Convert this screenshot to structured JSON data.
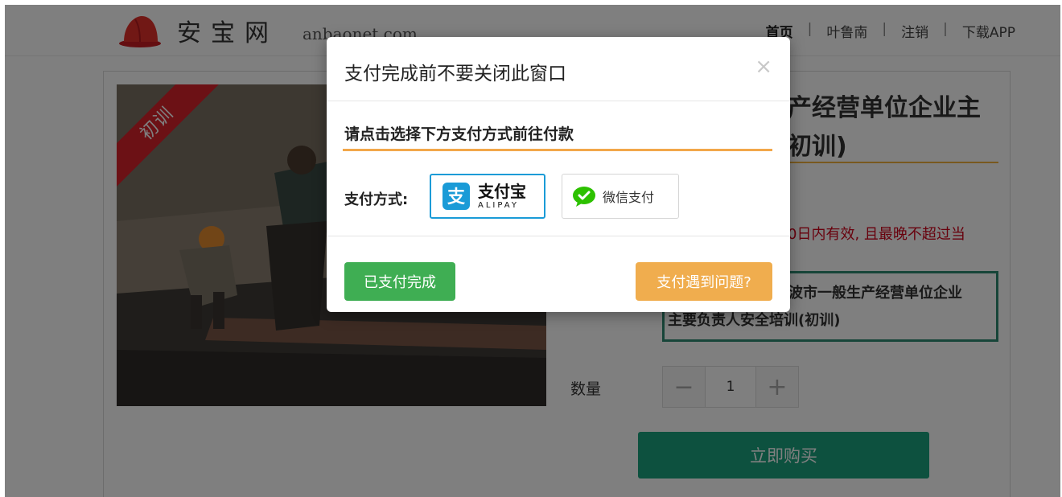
{
  "header": {
    "logo_cn": "安宝网",
    "logo_en": "anbaonet.com",
    "nav": {
      "home": "首页",
      "user": "叶鲁南",
      "logout": "注销",
      "download": "下载APP",
      "separator": "|"
    }
  },
  "product": {
    "ribbon": "初训",
    "title_lines": [
      "产经营单位企业主",
      "初训)"
    ],
    "validity": "0日内有效, 且最晚不超过当",
    "course_lines": [
      "波市一般生产经营单位企业",
      "主要负责人安全培训(初训)"
    ],
    "quantity_label": "数量",
    "quantity_value": "1",
    "minus": "−",
    "plus": "+",
    "buy_label": "立即购买"
  },
  "modal": {
    "title": "支付完成前不要关闭此窗口",
    "close": "×",
    "instruction": "请点击选择下方支付方式前往付款",
    "pay_method_label": "支付方式:",
    "alipay": {
      "cn": "支付宝",
      "en": "ALIPAY",
      "icon_glyph": "支",
      "color": "#1a9bd7"
    },
    "wechat": {
      "label": "微信支付",
      "color": "#2dc100"
    },
    "paid_button": "已支付完成",
    "problem_button": "支付遇到问题?"
  },
  "colors": {
    "buy": "#1aa37f",
    "paid": "#3fae53",
    "problem": "#f0ad4e",
    "ribbon": "#d9222a",
    "accent_line": "#f2a74a"
  }
}
